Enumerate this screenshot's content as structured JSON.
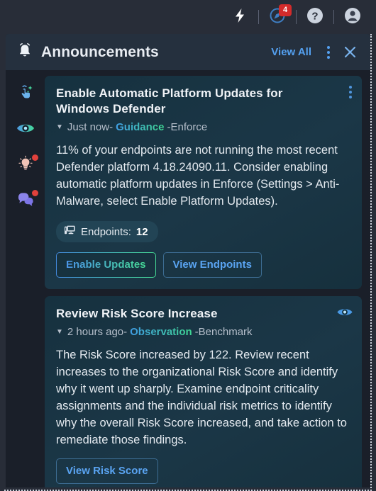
{
  "appbar": {
    "items": [
      {
        "name": "quick-actions-icon",
        "icon": "lightning-bolt"
      },
      {
        "name": "announcements-icon",
        "icon": "compass",
        "badge": "4"
      },
      {
        "name": "help-icon",
        "icon": "question-circle"
      },
      {
        "name": "account-icon",
        "icon": "user-avatar"
      }
    ]
  },
  "panel": {
    "title": "Announcements",
    "bell_icon": "bell-icon",
    "view_all_label": "View All",
    "menu_icon": "kebab-menu-icon",
    "close_icon": "close-icon"
  },
  "rail": {
    "items": [
      {
        "name": "rail-item-interactive-guides",
        "icon": "tap-sparkle-icon",
        "badge": false
      },
      {
        "name": "rail-item-observations",
        "icon": "eye-icon",
        "badge": false
      },
      {
        "name": "rail-item-insights",
        "icon": "lightbulb-icon",
        "badge": true
      },
      {
        "name": "rail-item-messages",
        "icon": "chat-bubbles-icon",
        "badge": true
      }
    ]
  },
  "announcements": [
    {
      "title": "Enable Automatic Platform Updates for Windows Defender",
      "timestamp": "Just now",
      "category": "Guidance",
      "source": "Enforce",
      "separator": "-",
      "body": "11% of your endpoints are not running the most recent Defender platform 4.18.24090.11. Consider enabling automatic platform updates in Enforce (Settings > Anti-Malware, select Enable Platform Updates).",
      "chip": {
        "icon": "endpoint-monitor-icon",
        "label": "Endpoints:",
        "value": "12"
      },
      "buttons": [
        {
          "label": "Enable Updates",
          "style": "gradient"
        },
        {
          "label": "View Endpoints",
          "style": "outline"
        }
      ],
      "header_icon": "kebab-menu-icon"
    },
    {
      "title": "Review Risk Score Increase",
      "timestamp": "2 hours ago",
      "category": "Observation",
      "source": "Benchmark",
      "separator": "-",
      "body": "The Risk Score increased by 122. Review recent increases to the organizational Risk Score and identify why it went up sharply. Examine endpoint criticality assignments and the individual risk metrics to identify why the overall Risk Score increased, and take action to remediate those findings.",
      "buttons": [
        {
          "label": "View Risk Score",
          "style": "outline"
        }
      ],
      "header_icon": "eye-icon"
    }
  ],
  "colors": {
    "app_background": "#282d38",
    "panel_background": "#1a1f29",
    "panel_header": "#25303e",
    "card_background": "#17323f",
    "accent_blue": "#54a0f0",
    "accent_green": "#45d994",
    "badge_red": "#d32b2b",
    "notification_dot": "#e1413c"
  }
}
